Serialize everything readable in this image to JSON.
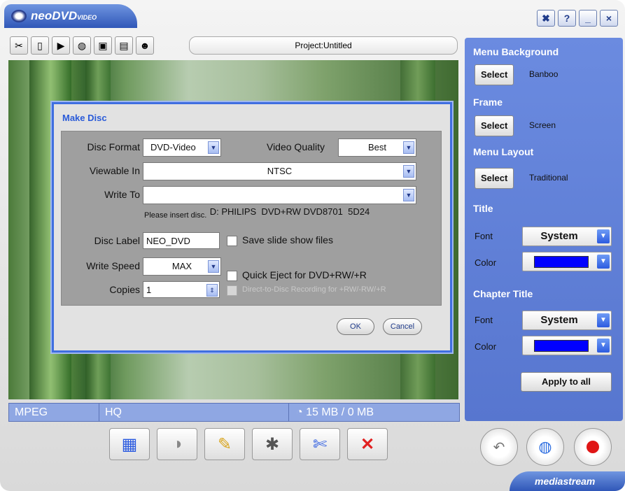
{
  "app": {
    "logo_text": "neoDVD",
    "logo_sub": "VIDEO",
    "brand": "mediastream"
  },
  "window_buttons": [
    "tools-icon",
    "help",
    "minimize",
    "close"
  ],
  "toolbar": {
    "icons": [
      "tools-icon",
      "new-icon",
      "open-icon",
      "globe-icon",
      "save-icon",
      "save-as-icon",
      "users-icon"
    ],
    "project": "Project:Untitled"
  },
  "status": {
    "format": "MPEG",
    "quality": "HQ",
    "size": "15 MB / 0 MB"
  },
  "panel": {
    "menu_background": {
      "heading": "Menu Background",
      "button": "Select",
      "value": "Banboo"
    },
    "frame": {
      "heading": "Frame",
      "button": "Select",
      "value": "Screen"
    },
    "menu_layout": {
      "heading": "Menu Layout",
      "button": "Select",
      "value": "Traditional"
    },
    "title": {
      "heading": "Title",
      "font_label": "Font",
      "font": "System",
      "color_label": "Color",
      "color": "#0000ff"
    },
    "chapter_title": {
      "heading": "Chapter Title",
      "font_label": "Font",
      "font": "System",
      "color_label": "Color",
      "color": "#0000ff"
    },
    "apply_all": "Apply to all"
  },
  "dialog": {
    "title": "Make Disc",
    "disc_format_label": "Disc Format",
    "disc_format": "DVD-Video",
    "video_quality_label": "Video Quality",
    "video_quality": "Best",
    "viewable_in_label": "Viewable In",
    "viewable_in": "NTSC",
    "write_to_label": "Write To",
    "write_to": "D: PHILIPS  DVD+RW DVD8701  5D24",
    "insert_msg": "Please insert disc.",
    "disc_label_label": "Disc Label",
    "disc_label": "NEO_DVD",
    "save_slide": "Save slide show files",
    "write_speed_label": "Write Speed",
    "write_speed": "MAX",
    "quick_eject": "Quick Eject for DVD+RW/+R",
    "copies_label": "Copies",
    "copies": "1",
    "direct_to_disc": "Direct-to-Disc Recording for +RW/-RW/+R",
    "ok": "OK",
    "cancel": "Cancel"
  }
}
